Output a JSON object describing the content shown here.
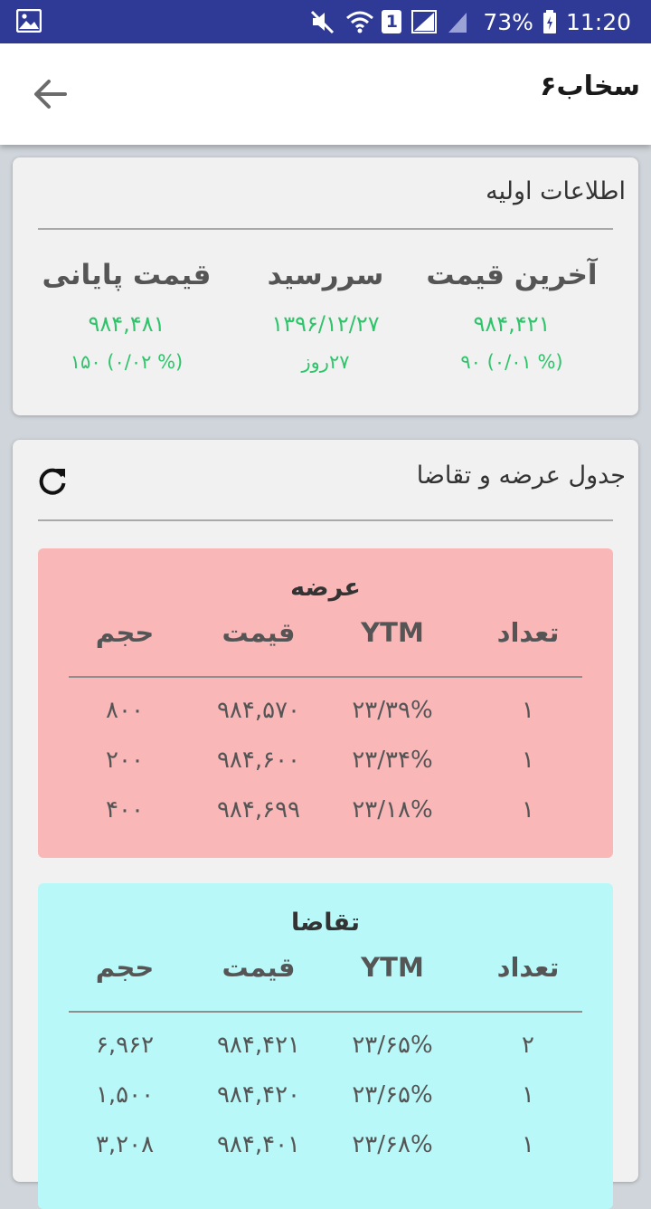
{
  "statusbar": {
    "battery": "73%",
    "time": "11:20",
    "sim_badge": "1",
    "icons": [
      "gallery-icon",
      "mute-icon",
      "wifi-icon",
      "sim-icon",
      "signal-icon",
      "battery-icon"
    ]
  },
  "appbar": {
    "title": "سخاب۶",
    "back_icon": "arrow-left-icon"
  },
  "info_card": {
    "title": "اطلاعات اولیه",
    "columns": [
      {
        "label": "آخرین قیمت",
        "value": "۹۸۴,۴۲۱",
        "sub": "(% ۰/۰۱)  ۹۰"
      },
      {
        "label": "سررسید",
        "value": "۱۳۹۶/۱۲/۲۷",
        "sub": "۲۷روز"
      },
      {
        "label": "قیمت پایانی",
        "value": "۹۸۴,۴۸۱",
        "sub": "(% ۰/۰۲) ۱۵۰"
      }
    ],
    "accent_color": "#2ec46a"
  },
  "orderbook_card": {
    "title": "جدول عرضه و تقاضا",
    "refresh_icon": "refresh-icon",
    "headers": {
      "count": "تعداد",
      "ytm": "YTM",
      "price": "قیمت",
      "volume": "حجم"
    },
    "ask": {
      "title": "عرضه",
      "color": "#f9b7b8",
      "rows": [
        {
          "count": "۱",
          "ytm": "۲۳/۳۹%",
          "price": "۹۸۴,۵۷۰",
          "volume": "۸۰۰"
        },
        {
          "count": "۱",
          "ytm": "۲۳/۳۴%",
          "price": "۹۸۴,۶۰۰",
          "volume": "۲۰۰"
        },
        {
          "count": "۱",
          "ytm": "۲۳/۱۸%",
          "price": "۹۸۴,۶۹۹",
          "volume": "۴۰۰"
        }
      ]
    },
    "bid": {
      "title": "تقاضا",
      "color": "#b8f8f8",
      "rows": [
        {
          "count": "۲",
          "ytm": "۲۳/۶۵%",
          "price": "۹۸۴,۴۲۱",
          "volume": "۶,۹۶۲"
        },
        {
          "count": "۱",
          "ytm": "۲۳/۶۵%",
          "price": "۹۸۴,۴۲۰",
          "volume": "۱,۵۰۰"
        },
        {
          "count": "۱",
          "ytm": "۲۳/۶۸%",
          "price": "۹۸۴,۴۰۱",
          "volume": "۳,۲۰۸"
        }
      ]
    }
  }
}
